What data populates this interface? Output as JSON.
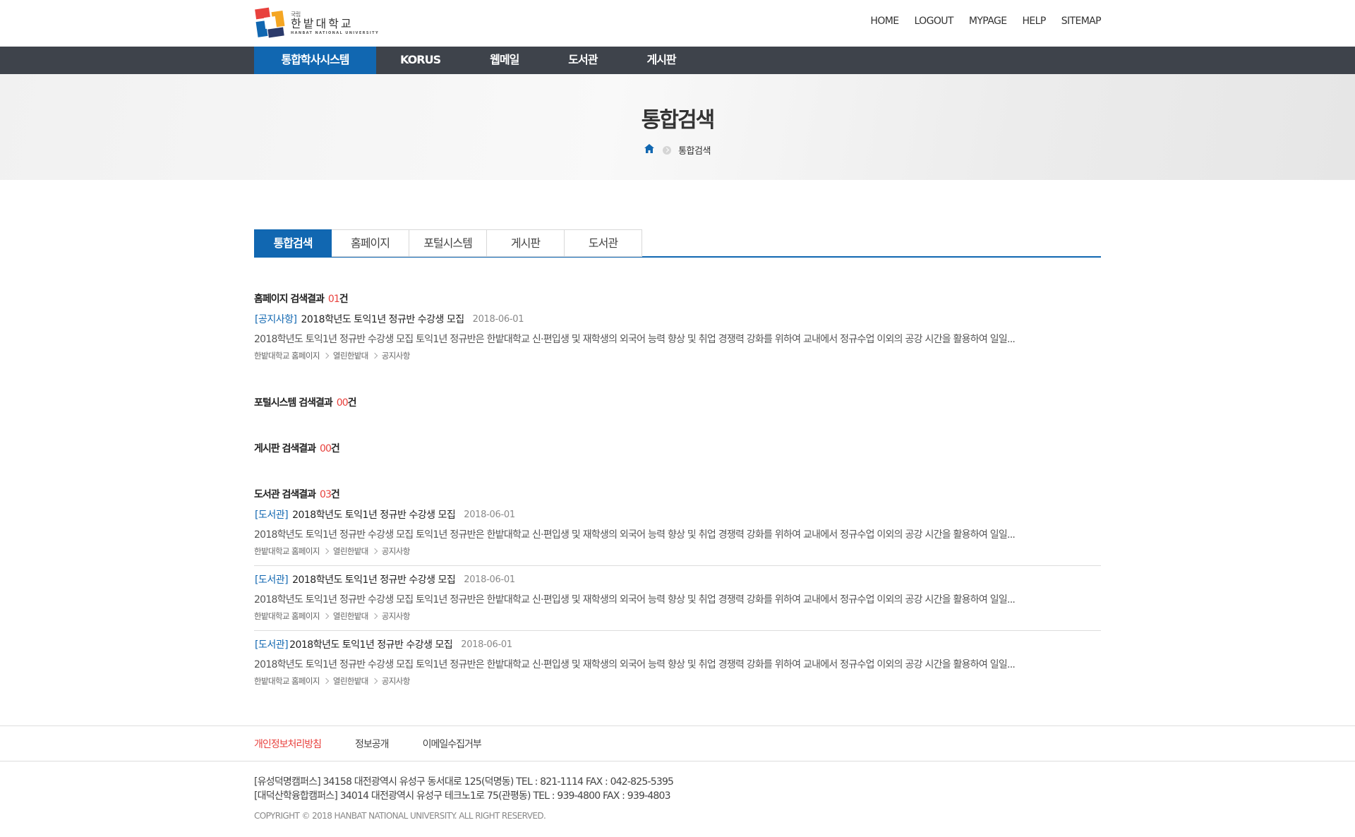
{
  "header": {
    "logo": {
      "small": "국립",
      "name": "한밭대학교",
      "eng": "HANBAT NATIONAL UNIVERSITY"
    },
    "util": [
      "HOME",
      "LOGOUT",
      "MYPAGE",
      "HELP",
      "SITEMAP"
    ]
  },
  "gnb": {
    "items": [
      "통합학사시스템",
      "KORUS",
      "웹메일",
      "도서관",
      "게시판"
    ],
    "active_index": 0
  },
  "visual": {
    "title": "통합검색",
    "breadcrumb": {
      "home_icon": "home-icon",
      "current": "통합검색"
    }
  },
  "tabs": {
    "items": [
      "통합검색",
      "홈페이지",
      "포털시스템",
      "게시판",
      "도서관"
    ],
    "active_index": 0
  },
  "results": {
    "homepage": {
      "title": "홈페이지 검색결과",
      "count": "01",
      "unit": "건",
      "items": [
        {
          "category": "[공지사항]",
          "title": "2018학년도 토익1년 정규반 수강생 모집",
          "date": "2018-06-01",
          "desc": "2018학년도 토익1년 정규반 수강생 모집 토익1년 정규반은 한밭대학교 신·편입생 및 재학생의 외국어 능력 향상 및 취업 경쟁력 강화를 위하여 교내에서 정규수업 이외의 공강 시간을 활용하여 일일...",
          "path": [
            "한밭대학교 홈페이지",
            "열린한밭대",
            "공지사항"
          ]
        }
      ]
    },
    "portal": {
      "title": "포털시스템 검색결과",
      "count": "00",
      "unit": "건"
    },
    "board": {
      "title": "게시판 검색결과",
      "count": "00",
      "unit": "건"
    },
    "library": {
      "title": "도서관 검색결과",
      "count": "03",
      "unit": "건",
      "items": [
        {
          "category": "[도서관]",
          "title": "2018학년도 토익1년 정규반 수강생 모집",
          "date": "2018-06-01",
          "desc": "2018학년도 토익1년 정규반 수강생 모집 토익1년 정규반은 한밭대학교 신·편입생 및 재학생의 외국어 능력 향상 및 취업 경쟁력 강화를 위하여 교내에서 정규수업 이외의 공강 시간을 활용하여 일일...",
          "path": [
            "한밭대학교 홈페이지",
            "열린한밭대",
            "공지사항"
          ]
        },
        {
          "category": "[도서관]",
          "title": "2018학년도 토익1년 정규반 수강생 모집",
          "date": "2018-06-01",
          "desc": "2018학년도 토익1년 정규반 수강생 모집 토익1년 정규반은 한밭대학교 신·편입생 및 재학생의 외국어 능력 향상 및 취업 경쟁력 강화를 위하여 교내에서 정규수업 이외의 공강 시간을 활용하여 일일...",
          "path": [
            "한밭대학교 홈페이지",
            "열린한밭대",
            "공지사항"
          ]
        },
        {
          "category": "[도서관]",
          "title": "2018학년도 토익1년 정규반 수강생 모집",
          "date": "2018-06-01",
          "desc": "2018학년도 토익1년 정규반 수강생 모집 토익1년 정규반은 한밭대학교 신·편입생 및 재학생의 외국어 능력 향상 및 취업 경쟁력 강화를 위하여 교내에서 정규수업 이외의 공강 시간을 활용하여 일일...",
          "path": [
            "한밭대학교 홈페이지",
            "열린한밭대",
            "공지사항"
          ]
        }
      ]
    }
  },
  "footer": {
    "links": [
      "개인정보처리방침",
      "정보공개",
      "이메일수집거부"
    ],
    "address1": "[유성덕명캠퍼스] 34158 대전광역시 유성구 동서대로 125(덕명동) TEL : 821-1114 FAX : 042-825-5395",
    "address2": "[대덕산학융합캠퍼스] 34014 대전광역시 유성구 테크노1로 75(관평동) TEL : 939-4800 FAX : 939-4803",
    "copyright": "COPYRIGHT © 2018 HANBAT NATIONAL UNIVERSITY. ALL RIGHT RESERVED."
  },
  "colors": {
    "brand_blue": "#1167b1",
    "gnb_bg": "#3e434b",
    "count_red": "#e8413d"
  }
}
